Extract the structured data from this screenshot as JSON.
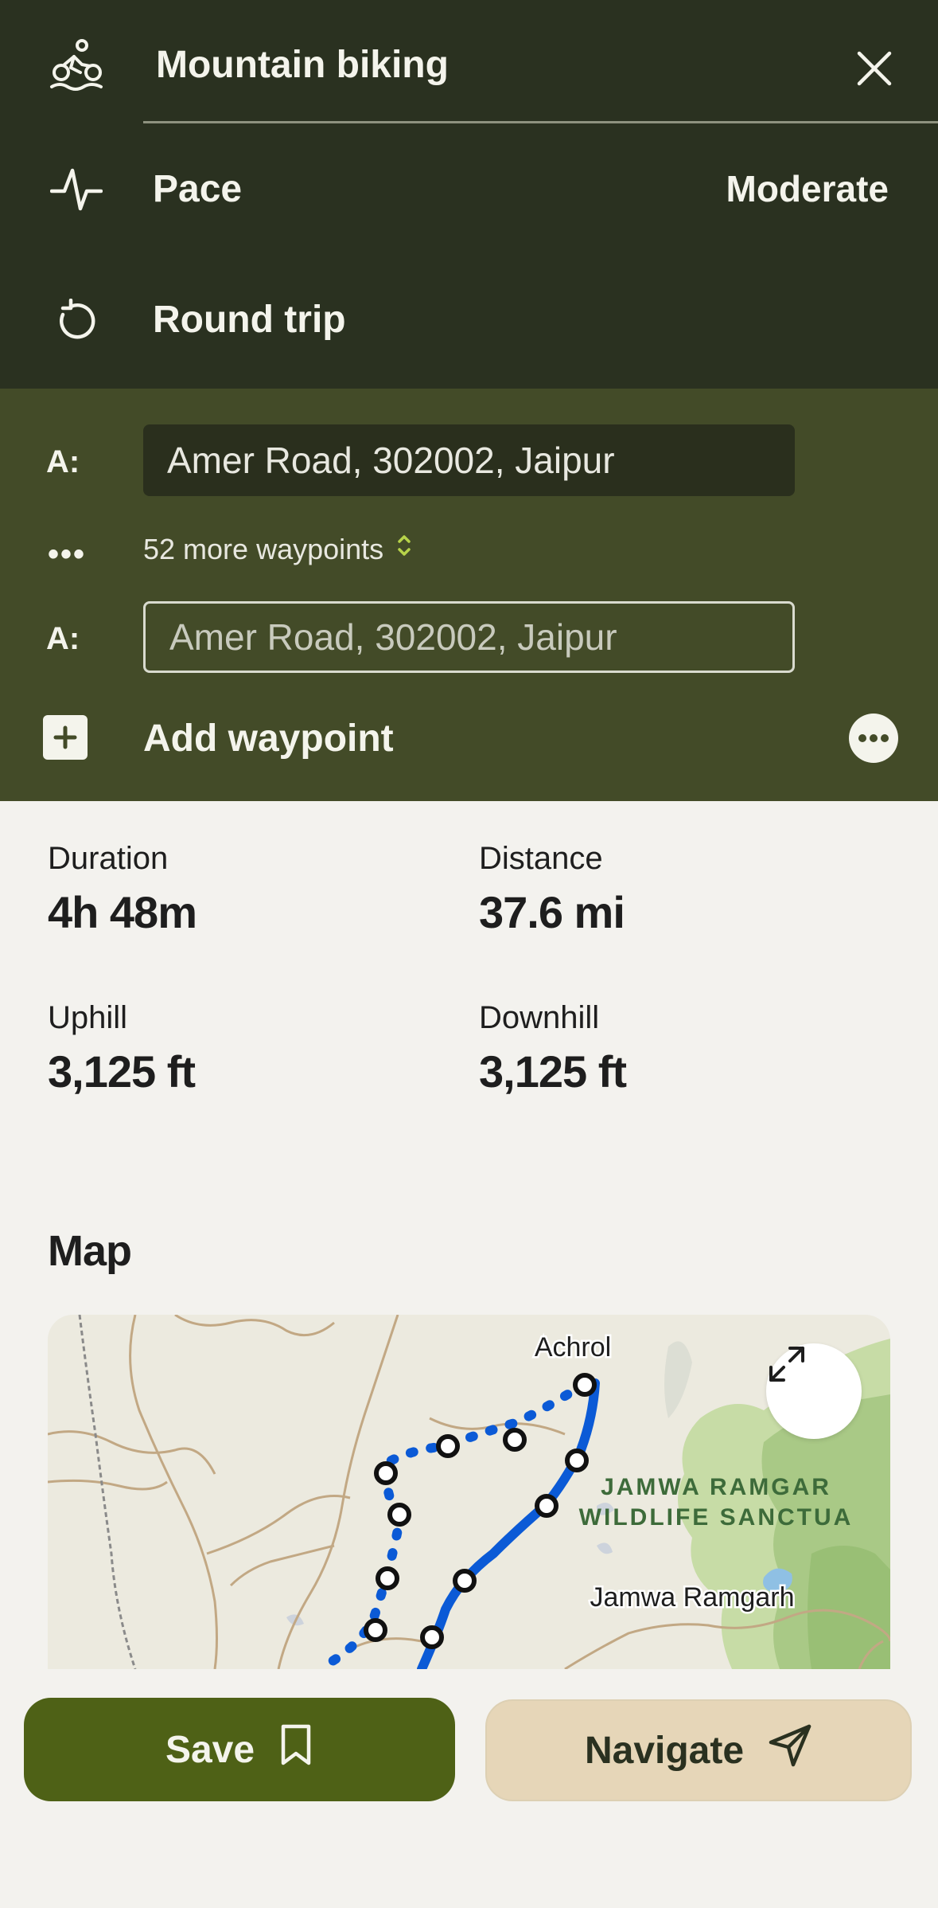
{
  "header": {
    "activity_label": "Mountain biking",
    "pace_label": "Pace",
    "pace_value": "Moderate",
    "trip_type_label": "Round trip"
  },
  "waypoints": {
    "start_label": "A:",
    "start_value": "Amer Road, 302002, Jaipur",
    "more_text": "52 more waypoints",
    "end_label": "A:",
    "end_value": "Amer Road, 302002, Jaipur",
    "add_label": "Add waypoint"
  },
  "stats": {
    "duration_label": "Duration",
    "duration_value": "4h 48m",
    "distance_label": "Distance",
    "distance_value": "37.6 mi",
    "uphill_label": "Uphill",
    "uphill_value": "3,125 ft",
    "downhill_label": "Downhill",
    "downhill_value": "3,125 ft"
  },
  "map": {
    "title": "Map",
    "place_achrol": "Achrol",
    "place_sanctuary_line1": "JAMWA RAMGAR",
    "place_sanctuary_line2": "WILDLIFE SANCTUA",
    "place_jamwa": "Jamwa Ramgarh"
  },
  "actions": {
    "save_label": "Save",
    "navigate_label": "Navigate"
  },
  "colors": {
    "header_bg": "#2a3120",
    "waypoints_bg": "#434b28",
    "save_bg": "#4e6116",
    "navigate_bg": "#e6d6b8",
    "route": "#0b5ad6"
  },
  "icons": {
    "activity": "mountain-bike-icon",
    "close": "close-icon",
    "pace": "pulse-icon",
    "round_trip": "round-trip-icon",
    "add": "plus-square-icon",
    "more": "more-horizontal-icon",
    "expand": "expand-icon",
    "bookmark": "bookmark-icon",
    "navigate": "navigation-arrow-icon"
  }
}
